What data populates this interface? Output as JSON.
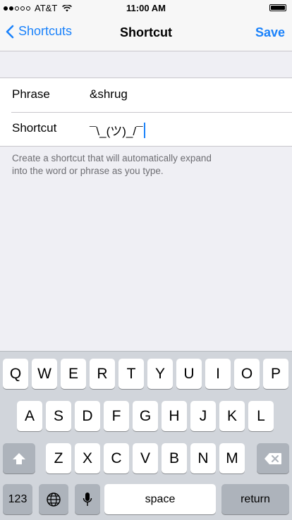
{
  "status_bar": {
    "carrier": "AT&T",
    "time": "11:00 AM",
    "signal_bars": [
      true,
      true,
      false,
      false,
      false
    ]
  },
  "nav": {
    "back_label": "Shortcuts",
    "title": "Shortcut",
    "save_label": "Save"
  },
  "form": {
    "phrase_label": "Phrase",
    "phrase_value": "&shrug",
    "shortcut_label": "Shortcut",
    "shortcut_value": "¯\\_(ツ)_/¯"
  },
  "footer_note": "Create a shortcut that will automatically expand into the word or phrase as you type.",
  "keyboard": {
    "row1": [
      "Q",
      "W",
      "E",
      "R",
      "T",
      "Y",
      "U",
      "I",
      "O",
      "P"
    ],
    "row2": [
      "A",
      "S",
      "D",
      "F",
      "G",
      "H",
      "J",
      "K",
      "L"
    ],
    "row3": [
      "Z",
      "X",
      "C",
      "V",
      "B",
      "N",
      "M"
    ],
    "numbers_label": "123",
    "space_label": "space",
    "return_label": "return"
  },
  "colors": {
    "accent": "#1a82fb",
    "background": "#efeff4",
    "keyboard_bg": "#d1d5db",
    "dark_key": "#adb3bb"
  },
  "icons": [
    "back-chevron-icon",
    "wifi-icon",
    "battery-icon",
    "shift-icon",
    "delete-icon",
    "globe-icon",
    "microphone-icon"
  ]
}
